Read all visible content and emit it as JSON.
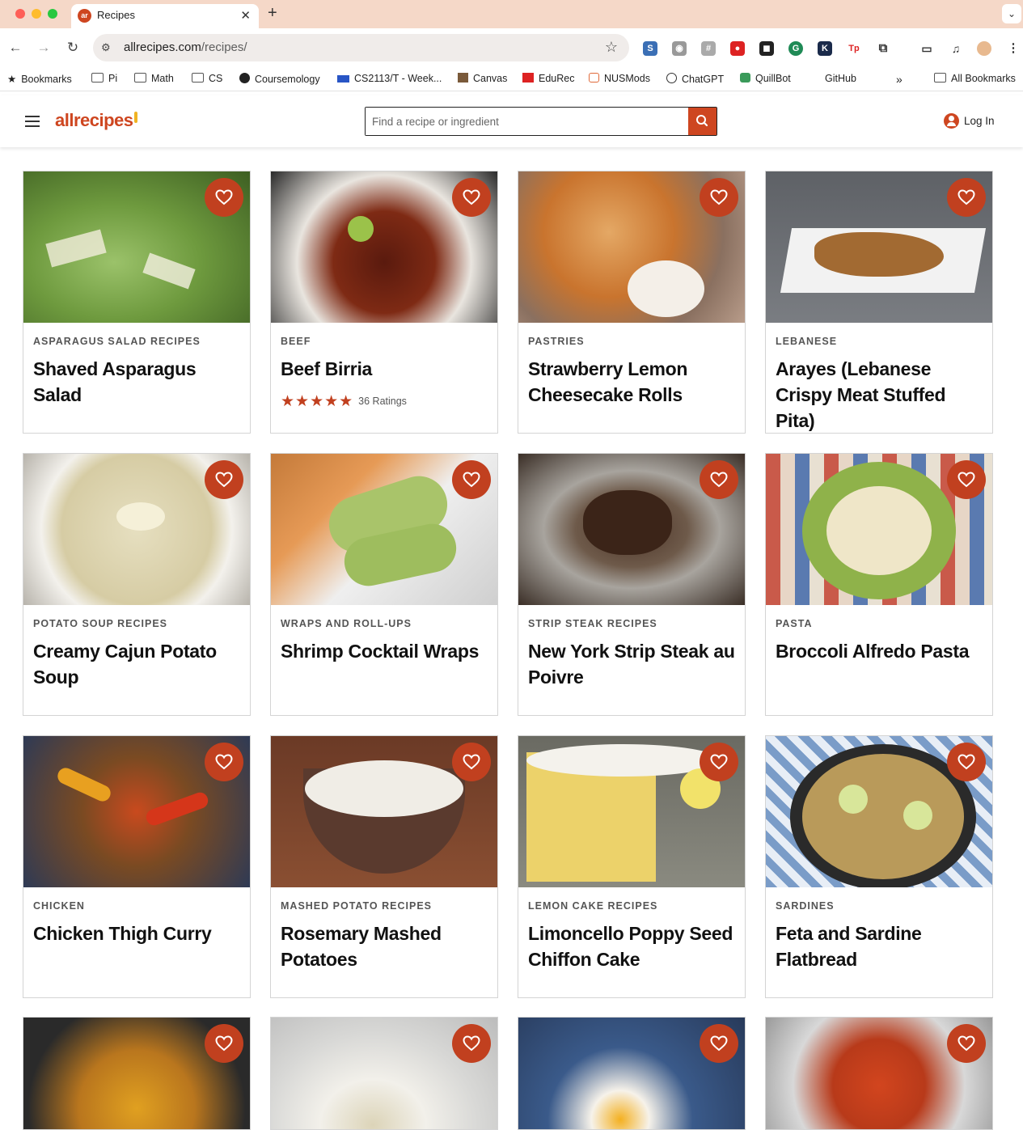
{
  "browser": {
    "tab_title": "Recipes",
    "tab_favicon_text": "ar",
    "url_host": "allrecipes.com",
    "url_path": "/recipes/",
    "bookmarks": [
      {
        "label": "Bookmarks",
        "icon": "star-icon"
      },
      {
        "label": "Pi",
        "icon": "folder-icon"
      },
      {
        "label": "Math",
        "icon": "folder-icon"
      },
      {
        "label": "CS",
        "icon": "folder-icon"
      },
      {
        "label": "Coursemology",
        "icon": "coursemology-icon"
      },
      {
        "label": "CS2113/T - Week...",
        "icon": "graduation-cap-icon"
      },
      {
        "label": "Canvas",
        "icon": "canvas-icon"
      },
      {
        "label": "EduRec",
        "icon": "edurec-icon"
      },
      {
        "label": "NUSMods",
        "icon": "nusmods-icon"
      },
      {
        "label": "ChatGPT",
        "icon": "chatgpt-icon"
      },
      {
        "label": "QuillBot",
        "icon": "quillbot-icon"
      },
      {
        "label": "GitHub",
        "icon": "github-icon"
      },
      {
        "label": "All Bookmarks",
        "icon": "folder-icon"
      }
    ]
  },
  "header": {
    "logo": "allrecipes",
    "search_placeholder": "Find a recipe or ingredient",
    "login_label": "Log In"
  },
  "colors": {
    "brand": "#ce4620",
    "heart_bg": "#c1401f"
  },
  "cards": [
    {
      "tag": "ASPARAGUS SALAD RECIPES",
      "title": "Shaved Asparagus Salad"
    },
    {
      "tag": "BEEF",
      "title": "Beef Birria",
      "rating_label": "36 Ratings",
      "stars": 5
    },
    {
      "tag": "PASTRIES",
      "title": "Strawberry Lemon Cheesecake Rolls"
    },
    {
      "tag": "LEBANESE",
      "title": "Arayes (Lebanese Crispy Meat Stuffed Pita)"
    },
    {
      "tag": "POTATO SOUP RECIPES",
      "title": "Creamy Cajun Potato Soup"
    },
    {
      "tag": "WRAPS AND ROLL-UPS",
      "title": "Shrimp Cocktail Wraps"
    },
    {
      "tag": "STRIP STEAK RECIPES",
      "title": "New York Strip Steak au Poivre"
    },
    {
      "tag": "PASTA",
      "title": "Broccoli Alfredo Pasta"
    },
    {
      "tag": "CHICKEN",
      "title": "Chicken Thigh Curry"
    },
    {
      "tag": "MASHED POTATO RECIPES",
      "title": "Rosemary Mashed Potatoes"
    },
    {
      "tag": "LEMON CAKE RECIPES",
      "title": "Limoncello Poppy Seed Chiffon Cake"
    },
    {
      "tag": "SARDINES",
      "title": "Feta and Sardine Flatbread"
    }
  ]
}
